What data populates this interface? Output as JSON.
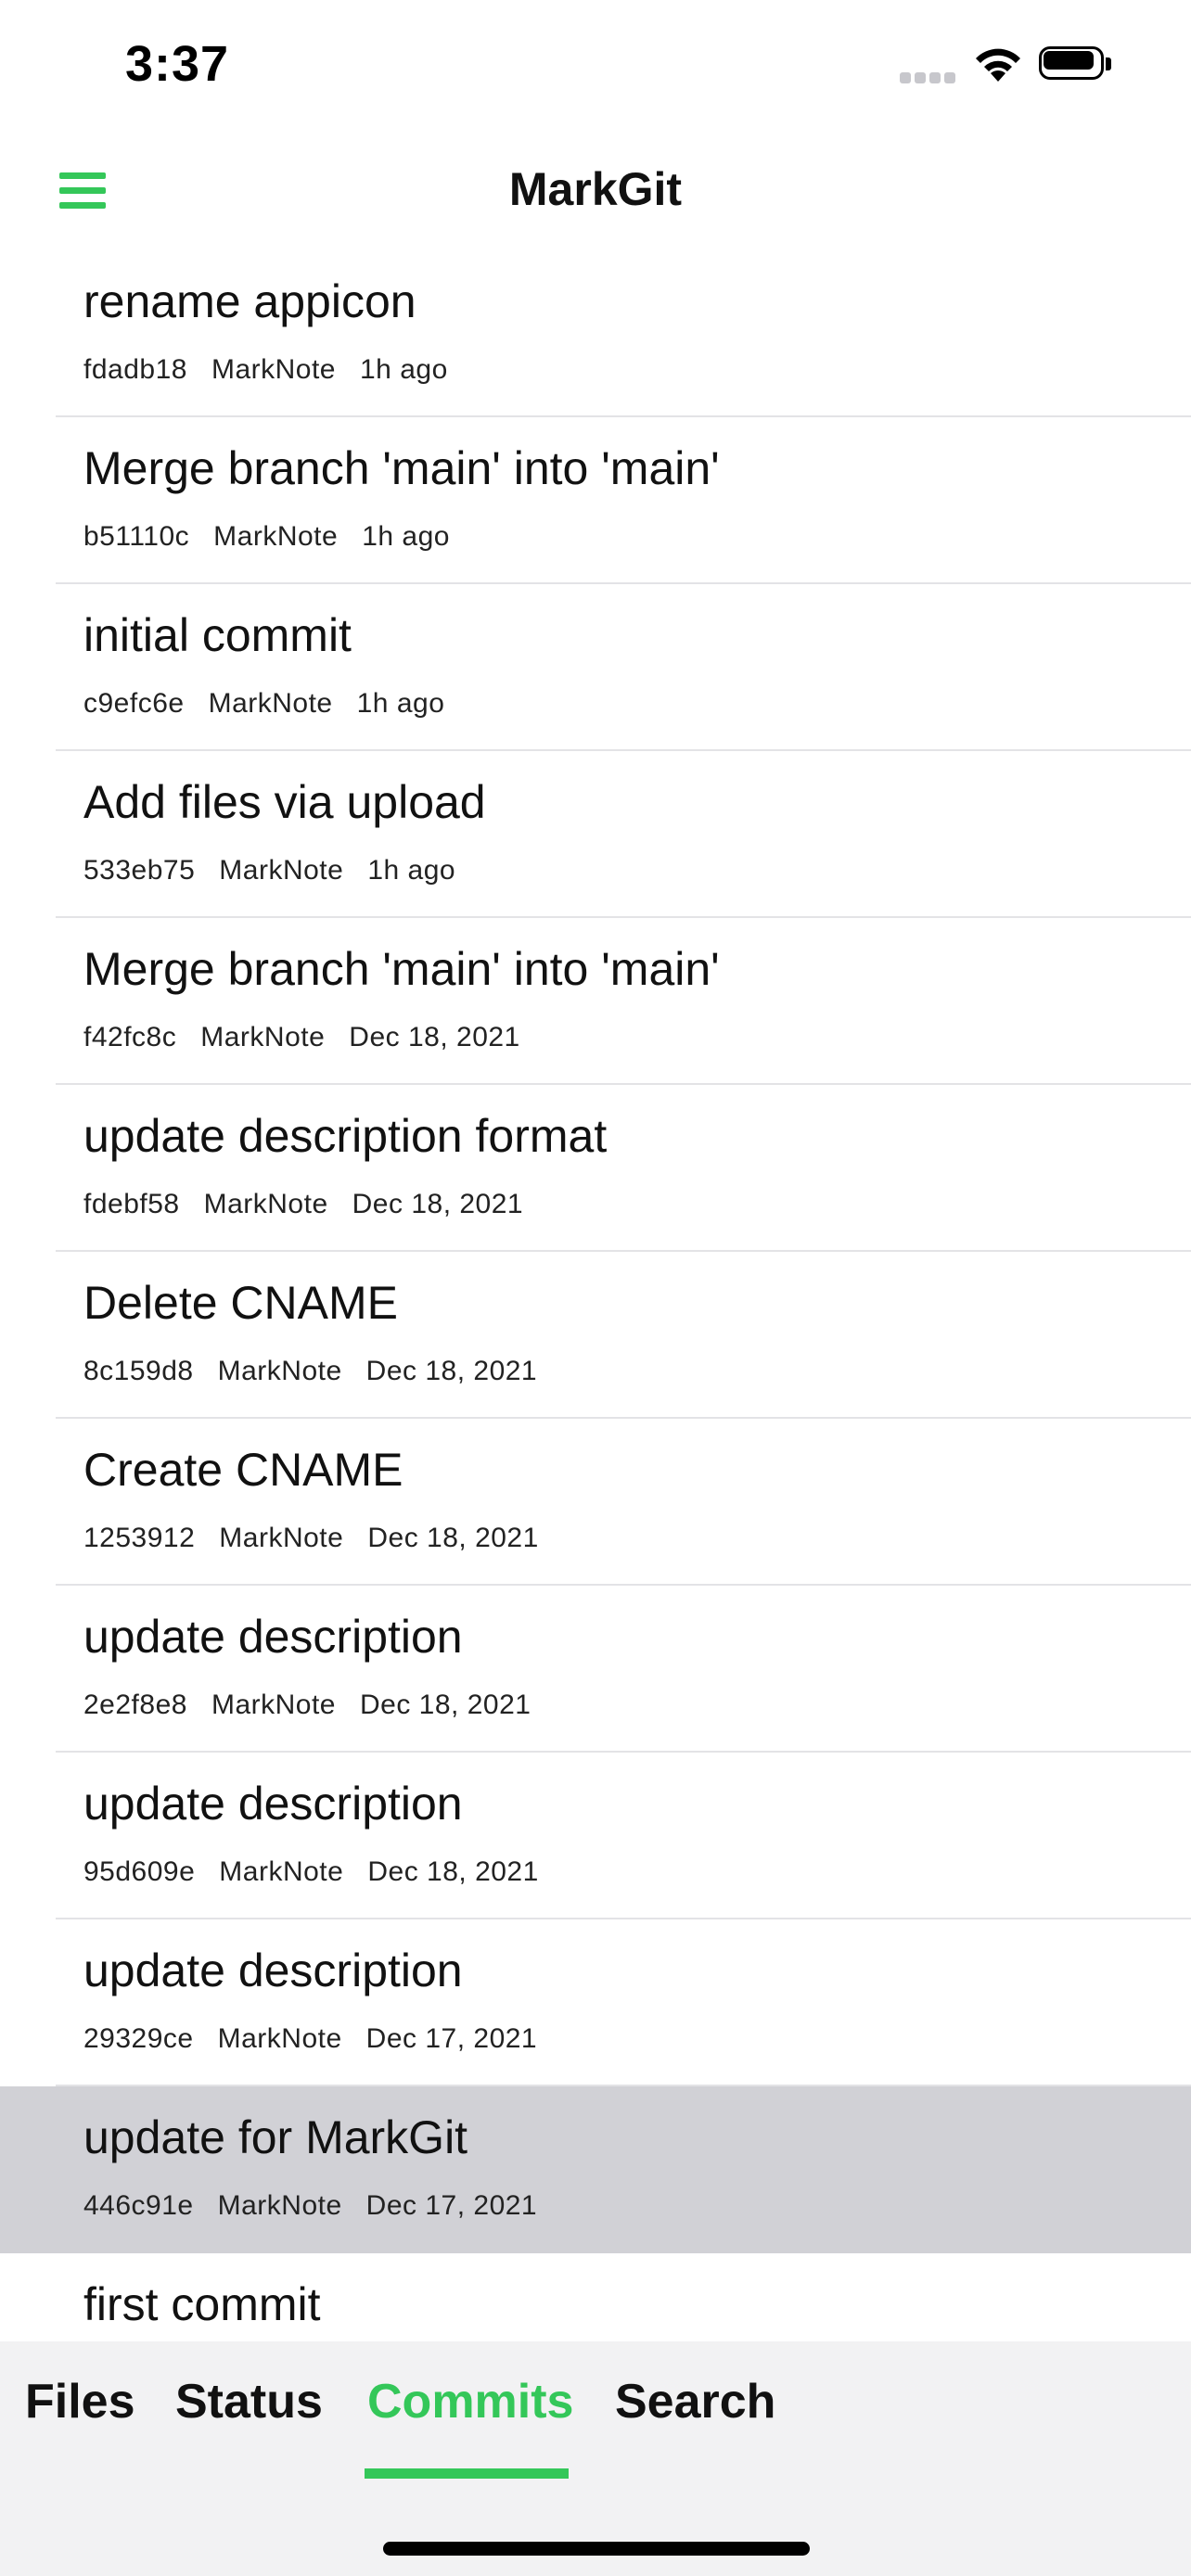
{
  "status_bar": {
    "time": "3:37"
  },
  "header": {
    "title": "MarkGit",
    "menu_icon": "hamburger-menu-icon"
  },
  "commits": [
    {
      "message": "rename appicon",
      "hash": "fdadb18",
      "author": "MarkNote",
      "time": "1h ago"
    },
    {
      "message": "Merge branch 'main' into 'main'",
      "hash": "b51110c",
      "author": "MarkNote",
      "time": "1h ago"
    },
    {
      "message": "initial commit",
      "hash": "c9efc6e",
      "author": "MarkNote",
      "time": "1h ago"
    },
    {
      "message": "Add files via upload",
      "hash": "533eb75",
      "author": "MarkNote",
      "time": "1h ago"
    },
    {
      "message": "Merge branch 'main' into 'main'",
      "hash": "f42fc8c",
      "author": "MarkNote",
      "time": "Dec 18, 2021"
    },
    {
      "message": "update description format",
      "hash": "fdebf58",
      "author": "MarkNote",
      "time": "Dec 18, 2021"
    },
    {
      "message": "Delete CNAME",
      "hash": "8c159d8",
      "author": "MarkNote",
      "time": "Dec 18, 2021"
    },
    {
      "message": "Create CNAME",
      "hash": "1253912",
      "author": "MarkNote",
      "time": "Dec 18, 2021"
    },
    {
      "message": "update description",
      "hash": "2e2f8e8",
      "author": "MarkNote",
      "time": "Dec 18, 2021"
    },
    {
      "message": "update description",
      "hash": "95d609e",
      "author": "MarkNote",
      "time": "Dec 18, 2021"
    },
    {
      "message": "update description",
      "hash": "29329ce",
      "author": "MarkNote",
      "time": "Dec 17, 2021"
    },
    {
      "message": "update for MarkGit",
      "hash": "446c91e",
      "author": "MarkNote",
      "time": "Dec 17, 2021"
    },
    {
      "message": "first commit",
      "hash": "",
      "author": "",
      "time": ""
    }
  ],
  "selected_commit_index": 11,
  "tabs": [
    {
      "label": "Files"
    },
    {
      "label": "Status"
    },
    {
      "label": "Commits"
    },
    {
      "label": "Search"
    }
  ],
  "active_tab": "Commits",
  "colors": {
    "accent": "#34c759",
    "selected_row": "#d1d1d6",
    "tab_bar_background": "#f2f2f3"
  }
}
